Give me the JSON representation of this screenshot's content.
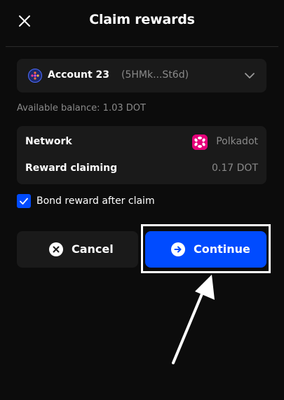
{
  "header": {
    "title": "Claim rewards",
    "close_icon": "close-icon"
  },
  "account": {
    "name": "Account 23",
    "address": "(5HMk...St6d)",
    "avatar_icon": "identicon-avatar",
    "chevron_icon": "chevron-down-icon"
  },
  "balance": {
    "text": "Available balance: 1.03 DOT"
  },
  "details": {
    "network_label": "Network",
    "network_value": "Polkadot",
    "network_icon": "polkadot-logo-icon",
    "reward_label": "Reward claiming",
    "reward_value": "0.17 DOT"
  },
  "bond": {
    "checked": true,
    "label": "Bond reward after claim"
  },
  "actions": {
    "cancel_label": "Cancel",
    "cancel_icon": "x-circle-icon",
    "continue_label": "Continue",
    "continue_icon": "arrow-right-circle-icon"
  },
  "colors": {
    "background": "#0c0c0c",
    "surface": "#1a1a1a",
    "accent": "#004bff",
    "muted_text": "#8a8a8a",
    "polkadot_pink": "#e6007a"
  }
}
